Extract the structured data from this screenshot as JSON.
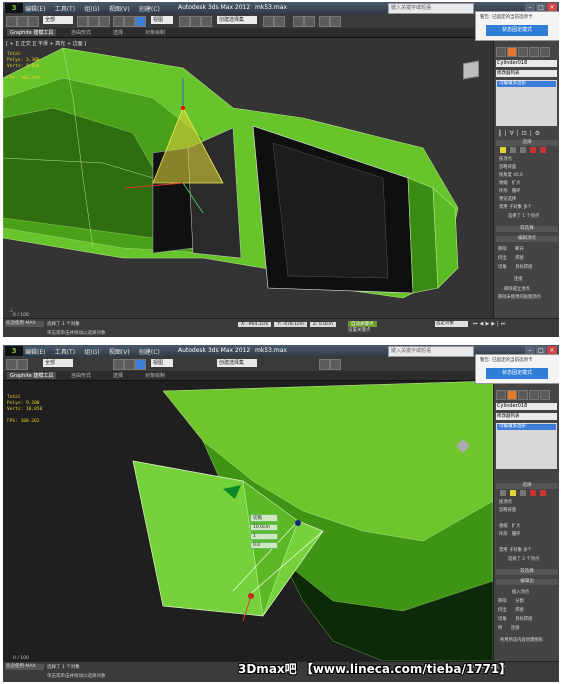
{
  "screen1": {
    "app_title": "Autodesk 3ds Max 2012",
    "file_name": "mk53.max",
    "search_placeholder": "键入关键字或短语",
    "menu": [
      "编辑(E)",
      "工具(T)",
      "组(G)",
      "视图(V)",
      "创建(C)",
      "修改器",
      "动画",
      "图形编辑器",
      "渲染(R)",
      "自定义(U)",
      "MAXScript(M)",
      "帮助(H)"
    ],
    "toolbar_select": "全部",
    "toolbar_view": "视图",
    "toolbar_selset": "创建选择集",
    "ribbon": {
      "tab1": "Graphite 建模工具",
      "tab2": "自由形式",
      "tab3": "选择",
      "tab4": "对象绘制"
    },
    "viewport_label": "[ + ][ 正交 ][ 平滑 + 高光 + 边面 ]",
    "stats": {
      "title": "Total",
      "polys": "Polys: 3,300",
      "verts": "Verts: 9,800",
      "fps_label": "FPS:",
      "fps": "100.504"
    },
    "tooltip": {
      "text": "警告: 已固定的当前选项卡",
      "button": "状态固定模式"
    },
    "panel": {
      "object_name": "Cylinder018",
      "modifier_list": "修改器列表",
      "stack_item": "可编辑多边形",
      "rollout_select": "选择",
      "by_vertex": "按顶点",
      "ignore_backface": "忽略背面",
      "by_angle": "按角度",
      "angle_val": "45.0",
      "shrink": "收缩",
      "grow": "扩大",
      "ring": "环形",
      "loop": "循环",
      "preview": "预览选择",
      "disabled": "禁用",
      "subobj": "子对象",
      "multi": "多个",
      "selected_count": "选择了 1 个顶点",
      "soft_sel": "软选择",
      "edit_vertices": "编辑顶点",
      "remove": "移除",
      "break": "断开",
      "extrude": "挤出",
      "weld": "焊接",
      "chamfer": "切角",
      "target_weld": "目标焊接",
      "connect": "连接",
      "remove_iso": "移除孤立顶点",
      "remove_unused": "移除未使用的贴图顶点"
    },
    "status": {
      "frame": "0 / 100",
      "selected": "选择了 1 个对象",
      "hint": "单击或单击并拖动以选择对象",
      "listener": "欢迎使用 MAX",
      "x": "X: -964.1cm",
      "y": "Y: -478.1cm",
      "z": "Z: 0.0cm",
      "auto_key": "自动关键点",
      "set_key": "设置关键点",
      "sel_filter": "选定对象",
      "key_filter": "关键点过滤器..."
    }
  },
  "screen2": {
    "app_title": "Autodesk 3ds Max 2012",
    "file_name": "mk53.max",
    "search_placeholder": "键入关键字或短语",
    "stats": {
      "title": "Total",
      "polys": "Polys: 9,200",
      "verts": "Verts: 10,050",
      "fps_label": "FPS:",
      "fps": "100.202"
    },
    "tooltip": {
      "text": "警告: 已固定的当前选项卡",
      "button": "状态固定模式"
    },
    "panel": {
      "object_name": "Cylinder018",
      "modifier_list": "修改器列表",
      "stack_item": "可编辑多边形",
      "selected_count": "选择了 2 个顶点",
      "insert_vertex": "插入顶点",
      "edit_edges": "编辑边",
      "split": "分割",
      "bridge": "桥",
      "use_as_shape": "利用所选内容创建图形"
    },
    "caddy": {
      "weld_label": "切角",
      "value1": "10.0cm",
      "value2": "1",
      "value3": "0.0"
    },
    "status": {
      "frame": "0 / 100",
      "selected": "选择了 1 个对象",
      "hint": "单击或单击并拖动以选择对象",
      "listener": "欢迎使用 MAX"
    }
  },
  "watermark": "3Dmax吧 【www.lineca.com/tieba/1771】",
  "colors": {
    "mesh_green": "#6fc62c",
    "dark_green": "#0c2a08",
    "accent_blue": "#2f7fd8",
    "selected_yellow": "#e3d530"
  }
}
